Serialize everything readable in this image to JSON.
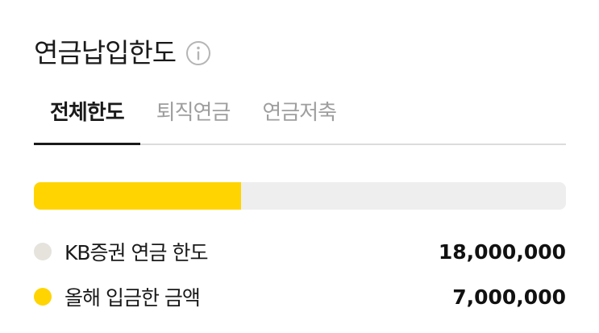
{
  "header": {
    "title": "연금납입한도",
    "info_icon": "info-circle-icon"
  },
  "tabs": [
    {
      "label": "전체한도",
      "active": true
    },
    {
      "label": "퇴직연금",
      "active": false
    },
    {
      "label": "연금저축",
      "active": false
    }
  ],
  "progress": {
    "fraction": 0.3889
  },
  "legend": [
    {
      "label": "KB증권 연금 한도",
      "value": "18,000,000",
      "color": "#e6e3dd"
    },
    {
      "label": "올해 입금한 금액",
      "value": "7,000,000",
      "color": "#ffd400"
    }
  ],
  "colors": {
    "accent": "#ffd400",
    "track": "#eeeeee",
    "inactive_tab": "#9e9e9e"
  }
}
